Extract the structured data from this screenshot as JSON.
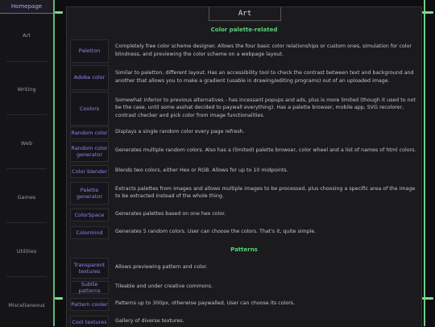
{
  "sidebar": {
    "home": "Homepage",
    "items": [
      "Art",
      "Writing",
      "Web",
      "Games",
      "Utilities",
      "Miscellaneous"
    ]
  },
  "panel": {
    "title": "Art"
  },
  "sections": {
    "palette": "Color palette-related",
    "patterns": "Patterns"
  },
  "rows": [
    {
      "name": "Paletton",
      "desc": "Completely free color scheme designer. Allows the four basic color relationships or custom ones, simulation for color blindness, and previewing the color scheme on a webpage layout."
    },
    {
      "name": "Adobe color",
      "desc": "Similar to paletton, different layout. Has an accessibility tool to check the contrast between text and background and another that allows you to make a gradient (usable in drawing/editing programs) out of an uploaded image."
    },
    {
      "name": "Coolors",
      "desc": "Somewhat inferior to previous alternatives - has incessant popups and ads, plus is more limited (though it used to not be the case, until some asshat decided to paywall everything). Has a palette browser, mobile app, SVG recolorer, contrast checker and pick color from image functionalities."
    },
    {
      "name": "Random color",
      "desc": "Displays a single random color every page refresh."
    },
    {
      "name": "Random color generator",
      "desc": "Generates multiple random colors. Also has a (limited) palette browser, color wheel and a list of names of html colors."
    },
    {
      "name": "Color blender",
      "desc": "Blends two colors, either Hex or RGB. Allows for up to 10 midpoints."
    },
    {
      "name": "Palette generator",
      "desc": "Extracts palettes from images and allows multiple images to be processed, plus choosing a specific area of the image to be extracted instead of the whole thing."
    },
    {
      "name": "ColorSpace",
      "desc": "Generates palettes based on one hex color."
    },
    {
      "name": "Colormind",
      "desc": "Generates 5 random colors. User can choose the colors. That's it, quite simple."
    },
    {
      "name": "Transparent textures",
      "desc": "Allows previewing pattern and color."
    },
    {
      "name": "Subtle patterns",
      "desc": "Tileable and under creative commons."
    },
    {
      "name": "Pattern cooler",
      "desc": "Patterns up to 300px, otherwise paywalled. User can choose its colors."
    },
    {
      "name": "Cool textures",
      "desc": "Gallery of diverse textures."
    }
  ]
}
